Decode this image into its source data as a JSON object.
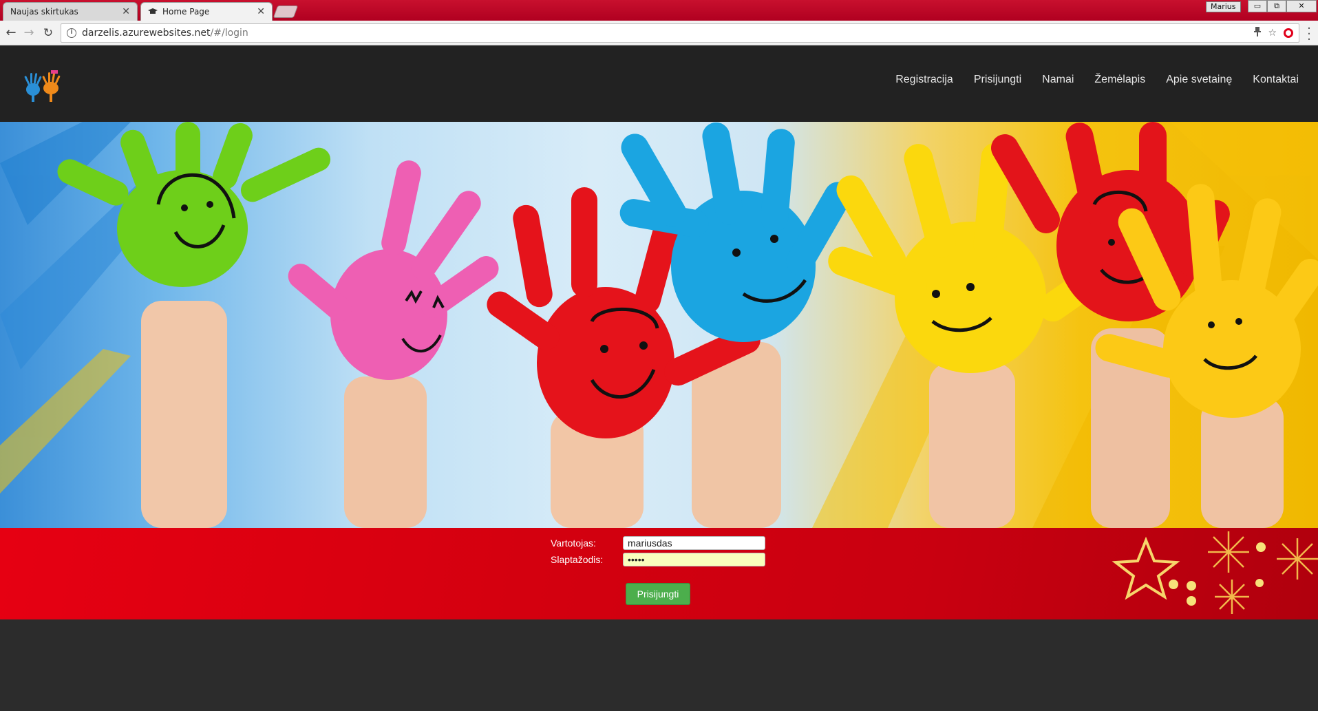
{
  "browser": {
    "tabs": [
      {
        "label": "Naujas skirtukas",
        "active": false
      },
      {
        "label": "Home Page",
        "active": true
      }
    ],
    "profile_name": "Marius",
    "window_buttons": {
      "minimize": "▭",
      "maximize": "⧉",
      "close": "✕"
    },
    "url_host": "darzelis.azurewebsites.net",
    "url_path": "/#/login"
  },
  "site": {
    "nav": [
      {
        "label": "Registracija"
      },
      {
        "label": "Prisijungti"
      },
      {
        "label": "Namai"
      },
      {
        "label": "Žemėlapis"
      },
      {
        "label": "Apie svetainę"
      },
      {
        "label": "Kontaktai"
      }
    ],
    "login": {
      "username_label": "Vartotojas:",
      "username_value": "mariusdas",
      "password_label": "Slaptažodis:",
      "password_value": "•••••",
      "submit_label": "Prisijungti"
    }
  },
  "colors": {
    "header_bg": "#222222",
    "band_red": "#d4000f",
    "button_green": "#4cae4c"
  }
}
